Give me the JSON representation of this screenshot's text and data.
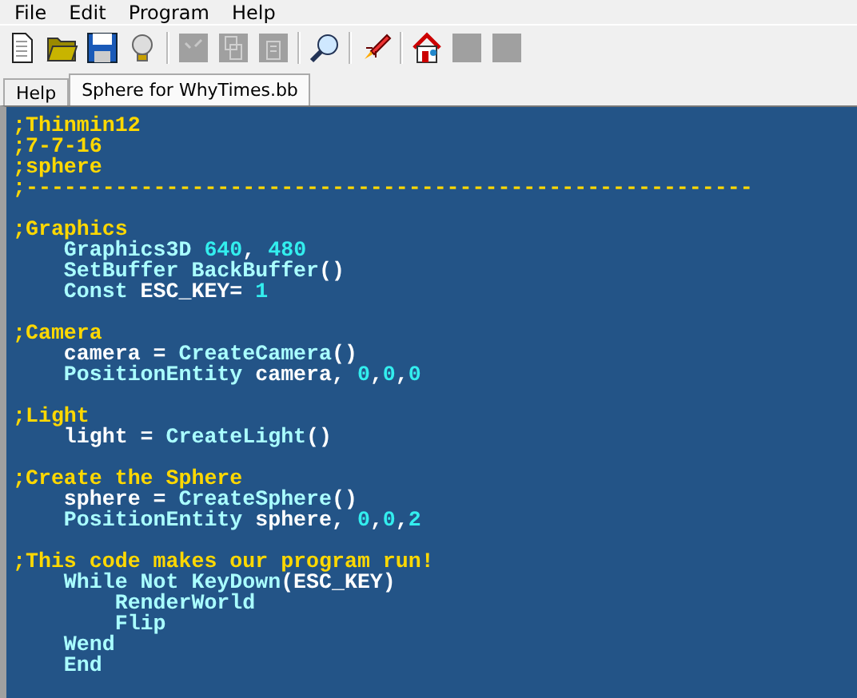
{
  "menu": [
    "File",
    "Edit",
    "Program",
    "Help"
  ],
  "toolbar": [
    {
      "kind": "new",
      "disabled": false
    },
    {
      "kind": "open",
      "disabled": false
    },
    {
      "kind": "save",
      "disabled": false
    },
    {
      "kind": "bulb",
      "disabled": false
    },
    {
      "kind": "sep"
    },
    {
      "kind": "cut",
      "disabled": true
    },
    {
      "kind": "copy",
      "disabled": true
    },
    {
      "kind": "paste",
      "disabled": true
    },
    {
      "kind": "sep"
    },
    {
      "kind": "find",
      "disabled": false
    },
    {
      "kind": "sep"
    },
    {
      "kind": "rocket",
      "disabled": false
    },
    {
      "kind": "sep"
    },
    {
      "kind": "home",
      "disabled": false
    },
    {
      "kind": "back",
      "disabled": true
    },
    {
      "kind": "forward",
      "disabled": true
    }
  ],
  "tabs": [
    {
      "label": "Help",
      "selected": false
    },
    {
      "label": "Sphere for WhyTimes.bb",
      "selected": true
    }
  ],
  "code_blocks": [
    {
      "lines": [
        [
          {
            "kind": "comment",
            "text": ";Thinmin12"
          }
        ],
        [
          {
            "kind": "comment",
            "text": ";7-7-16"
          }
        ],
        [
          {
            "kind": "comment",
            "text": ";sphere"
          }
        ],
        [
          {
            "kind": "comment",
            "text": ";---------------------------------------------------------"
          }
        ]
      ]
    },
    {
      "lines": [
        [
          {
            "kind": "comment",
            "text": ";Graphics"
          }
        ],
        [
          {
            "kind": "keyword",
            "text": "    Graphics3D "
          },
          {
            "kind": "number",
            "text": "640"
          },
          {
            "kind": "plain",
            "text": ", "
          },
          {
            "kind": "number",
            "text": "480"
          }
        ],
        [
          {
            "kind": "keyword",
            "text": "    SetBuffer BackBuffer"
          },
          {
            "kind": "plain",
            "text": "()"
          }
        ],
        [
          {
            "kind": "keyword",
            "text": "    Const "
          },
          {
            "kind": "plain",
            "text": "ESC_KEY= "
          },
          {
            "kind": "number",
            "text": "1"
          }
        ]
      ]
    },
    {
      "lines": [
        [
          {
            "kind": "comment",
            "text": ";Camera"
          }
        ],
        [
          {
            "kind": "plain",
            "text": "    camera = "
          },
          {
            "kind": "keyword",
            "text": "CreateCamera"
          },
          {
            "kind": "plain",
            "text": "()"
          }
        ],
        [
          {
            "kind": "keyword",
            "text": "    PositionEntity "
          },
          {
            "kind": "plain",
            "text": "camera, "
          },
          {
            "kind": "number",
            "text": "0"
          },
          {
            "kind": "plain",
            "text": ","
          },
          {
            "kind": "number",
            "text": "0"
          },
          {
            "kind": "plain",
            "text": ","
          },
          {
            "kind": "number",
            "text": "0"
          }
        ]
      ]
    },
    {
      "lines": [
        [
          {
            "kind": "comment",
            "text": ";Light"
          }
        ],
        [
          {
            "kind": "plain",
            "text": "    light = "
          },
          {
            "kind": "keyword",
            "text": "CreateLight"
          },
          {
            "kind": "plain",
            "text": "()"
          }
        ]
      ]
    },
    {
      "lines": [
        [
          {
            "kind": "comment",
            "text": ";Create the Sphere"
          }
        ],
        [
          {
            "kind": "plain",
            "text": "    sphere = "
          },
          {
            "kind": "keyword",
            "text": "CreateSphere"
          },
          {
            "kind": "plain",
            "text": "()"
          }
        ],
        [
          {
            "kind": "keyword",
            "text": "    PositionEntity "
          },
          {
            "kind": "plain",
            "text": "sphere, "
          },
          {
            "kind": "number",
            "text": "0"
          },
          {
            "kind": "plain",
            "text": ","
          },
          {
            "kind": "number",
            "text": "0"
          },
          {
            "kind": "plain",
            "text": ","
          },
          {
            "kind": "number",
            "text": "2"
          }
        ]
      ]
    },
    {
      "lines": [
        [
          {
            "kind": "comment",
            "text": ";This code makes our program run!"
          }
        ],
        [
          {
            "kind": "keyword",
            "text": "    While Not KeyDown"
          },
          {
            "kind": "plain",
            "text": "(ESC_KEY)"
          }
        ],
        [
          {
            "kind": "keyword",
            "text": "        RenderWorld"
          }
        ],
        [
          {
            "kind": "keyword",
            "text": "        Flip"
          }
        ],
        [
          {
            "kind": "keyword",
            "text": "    Wend"
          }
        ],
        [
          {
            "kind": "keyword",
            "text": "    End"
          }
        ]
      ]
    }
  ]
}
